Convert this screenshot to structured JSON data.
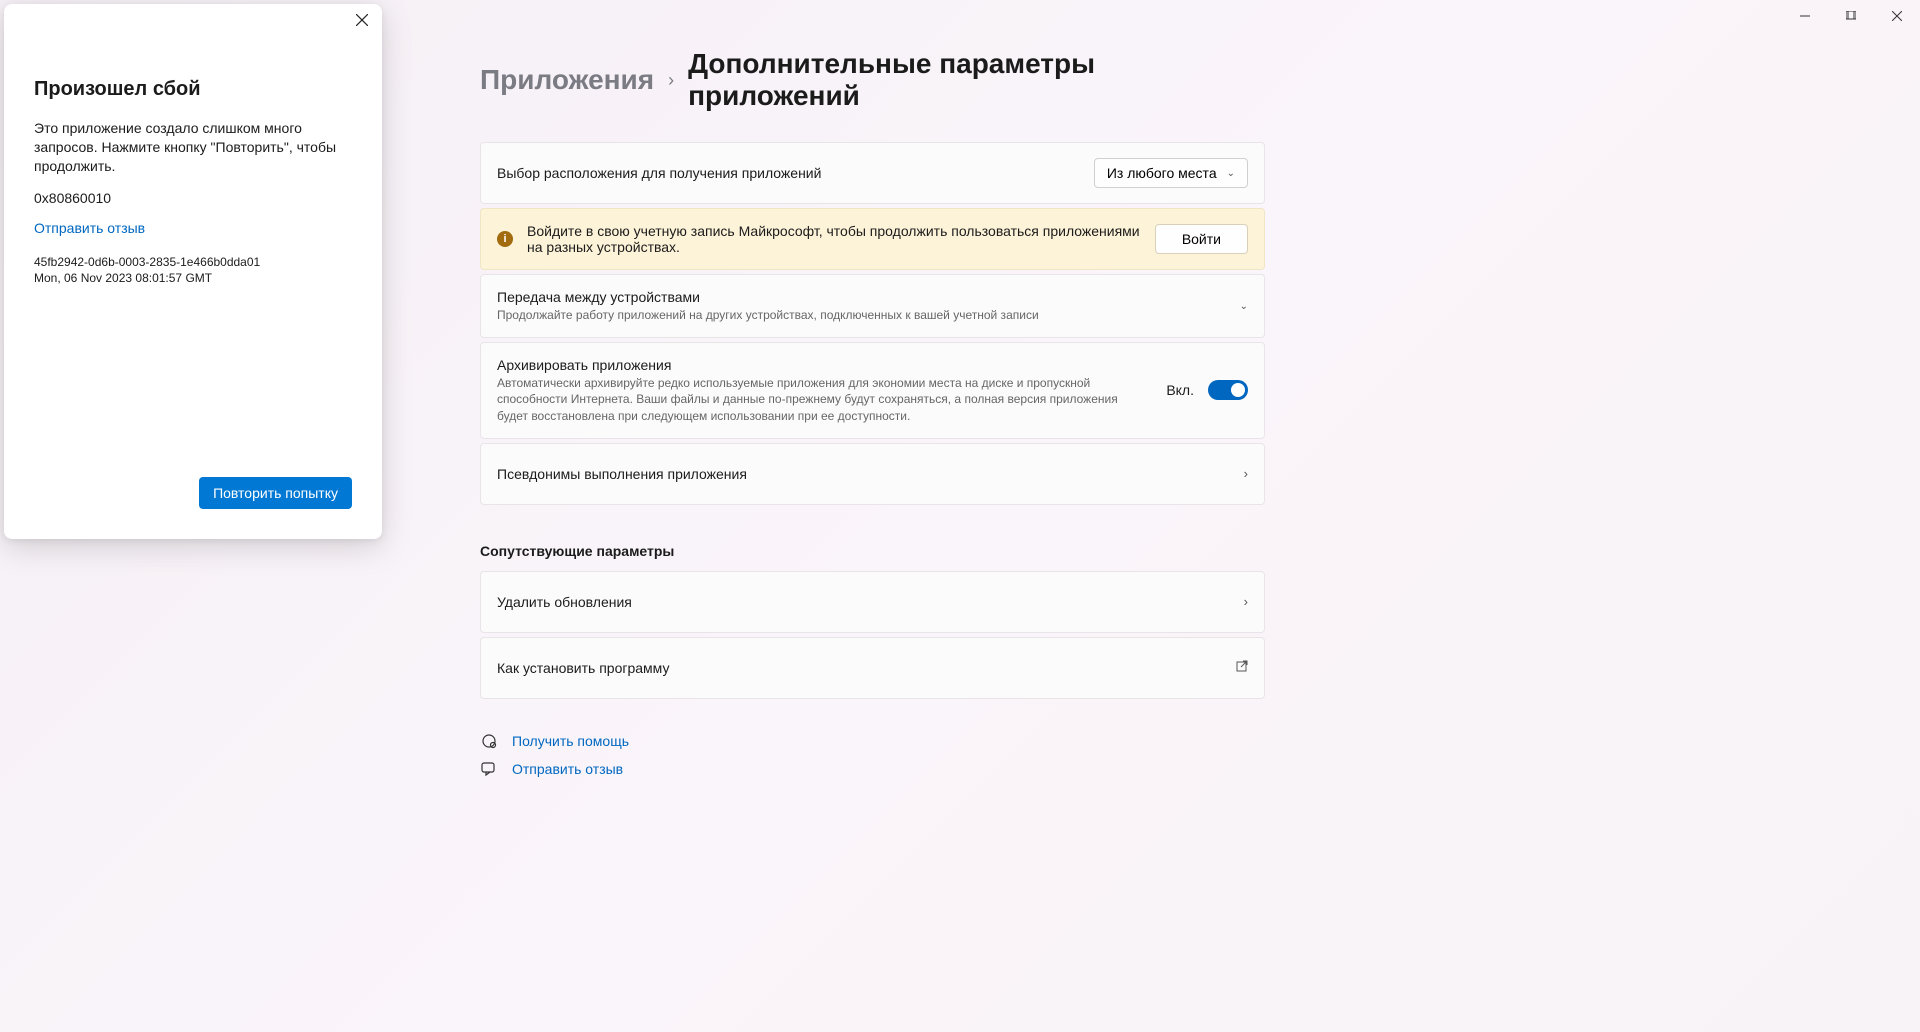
{
  "window": {
    "minimize": "—",
    "maximize": "❐",
    "close": "✕"
  },
  "dialog": {
    "title": "Произошел сбой",
    "message": "Это приложение создало слишком много запросов. Нажмите кнопку \"Повторить\", чтобы продолжить.",
    "error_code": "0x80860010",
    "feedback_link": "Отправить отзыв",
    "request_id": "45fb2942-0d6b-0003-2835-1e466b0dda01",
    "timestamp": "Mon, 06 Nov 2023 08:01:57 GMT",
    "retry_button": "Повторить попытку"
  },
  "breadcrumb": {
    "parent": "Приложения",
    "current": "Дополнительные параметры приложений"
  },
  "settings": {
    "app_source": {
      "label": "Выбор расположения для получения приложений",
      "value": "Из любого места"
    },
    "signin_banner": {
      "text": "Войдите в свою учетную запись Майкрософт, чтобы продолжить пользоваться приложениями на разных устройствах.",
      "button": "Войти"
    },
    "share_devices": {
      "title": "Передача между устройствами",
      "subtitle": "Продолжайте работу приложений на других устройствах, подключенных к вашей учетной записи"
    },
    "archive_apps": {
      "title": "Архивировать приложения",
      "subtitle": "Автоматически архивируйте редко используемые приложения для экономии места на диске и пропускной способности Интернета. Ваши файлы и данные по-прежнему будут сохраняться, а полная версия приложения будет восстановлена при следующем использовании при ее доступности.",
      "toggle_label": "Вкл."
    },
    "aliases": {
      "title": "Псевдонимы выполнения приложения"
    }
  },
  "related": {
    "header": "Сопутствующие параметры",
    "uninstall_updates": "Удалить обновления",
    "how_to_install": "Как установить программу"
  },
  "links": {
    "get_help": "Получить помощь",
    "feedback": "Отправить отзыв"
  }
}
